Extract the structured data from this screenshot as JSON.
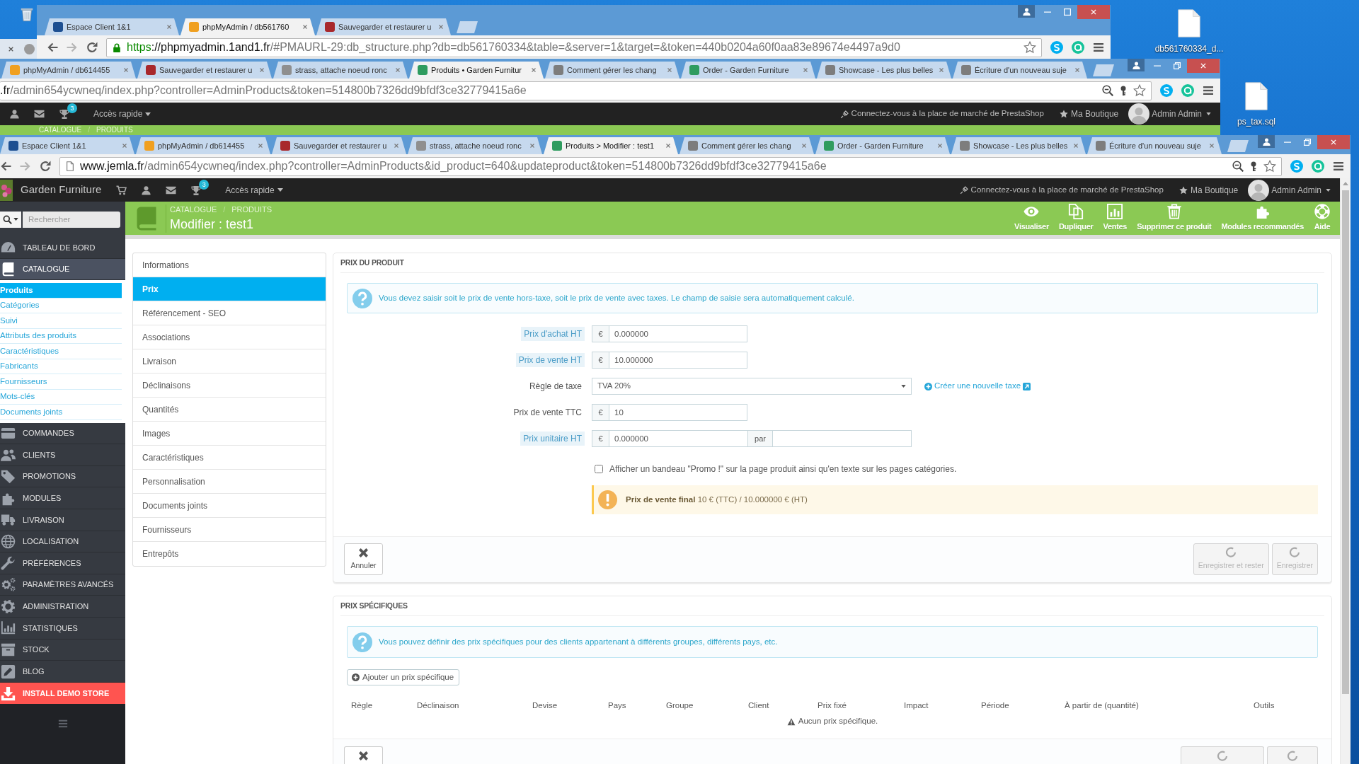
{
  "desktop": {
    "icons": [
      {
        "label": "db561760334_d..."
      },
      {
        "label": "ps_tax.sql"
      }
    ]
  },
  "windows": [
    {
      "kind": "sliver"
    },
    {
      "kind": "browser",
      "maximized": false,
      "tabs": [
        {
          "title": "Espace Client 1&1",
          "selected": false,
          "color": "#1d4f91"
        },
        {
          "title": "phpMyAdmin / db561760",
          "selected": true,
          "color": "#f0a020"
        },
        {
          "title": "Sauvegarder et restaurer u",
          "selected": false,
          "color": "#a8282c"
        }
      ],
      "toolbar": {
        "nav_buttons": true,
        "secure": true,
        "url": [
          {
            "kind": "scheme",
            "text": "https"
          },
          {
            "kind": "host",
            "text": "://phpmyadmin.1and1.fr"
          },
          {
            "kind": "path",
            "text": "/#PMAURL-29:db_structure.php?db=db561760334&table=&server=1&target=&token=440b0204a60f0aa83e89674e4497a9d0"
          }
        ],
        "zoomed": false,
        "saved_password": false
      }
    },
    {
      "kind": "browser",
      "maximized": true,
      "tabs": [
        {
          "title": "phpMyAdmin / db614455",
          "selected": false,
          "color": "#f0a020"
        },
        {
          "title": "Sauvegarder et restaurer u",
          "selected": false,
          "color": "#a8282c"
        },
        {
          "title": "strass, attache noeud ronc",
          "selected": false,
          "color": "#8f8f8f"
        },
        {
          "title": "Produits • Garden Furnitur",
          "selected": true,
          "color": "#2f9c5f"
        },
        {
          "title": "Comment gérer les chang",
          "selected": false,
          "color": "#7d7d7d"
        },
        {
          "title": "Order - Garden Furniture",
          "selected": false,
          "color": "#2f9c5f"
        },
        {
          "title": "Showcase - Les plus belles",
          "selected": false,
          "color": "#7d7d7d"
        },
        {
          "title": "Écriture d'un nouveau suje",
          "selected": false,
          "color": "#7d7d7d"
        }
      ],
      "toolbar": {
        "nav_buttons": false,
        "url": [
          {
            "kind": "host",
            "text": ".fr"
          },
          {
            "kind": "path",
            "text": "/admin654ycwneq/index.php?controller=AdminProducts&token=514800b7326dd9bfdf3ce32779415a6e"
          }
        ],
        "zoomed": true,
        "saved_password": true
      },
      "page": {
        "admin_header": {
          "notifications": "3",
          "quick_access": "Accès rapide",
          "marketplace": "Connectez-vous à la place de marché de PrestaShop",
          "shop": "Ma Boutique",
          "user": "Admin Admin"
        },
        "header": {
          "breadcrumb": [
            "CATALOGUE",
            "PRODUITS"
          ],
          "separator": "/"
        }
      }
    },
    {
      "kind": "browser",
      "maximized": true,
      "tabs": [
        {
          "title": "Espace Client 1&1",
          "selected": false,
          "color": "#1d4f91"
        },
        {
          "title": "phpMyAdmin / db614455",
          "selected": false,
          "color": "#f0a020"
        },
        {
          "title": "Sauvegarder et restaurer u",
          "selected": false,
          "color": "#a8282c"
        },
        {
          "title": "strass, attache noeud ronc",
          "selected": false,
          "color": "#8f8f8f"
        },
        {
          "title": "Produits > Modifier : test1",
          "selected": true,
          "color": "#2f9c5f"
        },
        {
          "title": "Comment gérer les chang",
          "selected": false,
          "color": "#7d7d7d"
        },
        {
          "title": "Order - Garden Furniture",
          "selected": false,
          "color": "#2f9c5f"
        },
        {
          "title": "Showcase - Les plus belles",
          "selected": false,
          "color": "#7d7d7d"
        },
        {
          "title": "Écriture d'un nouveau suje",
          "selected": false,
          "color": "#7d7d7d"
        }
      ],
      "toolbar": {
        "nav_buttons": true,
        "secure": false,
        "url": [
          {
            "kind": "host",
            "text": "www.jemla.fr"
          },
          {
            "kind": "path",
            "text": "/admin654ycwneq/index.php?controller=AdminProducts&id_product=640&updateproduct&token=514800b7326dd9bfdf3ce32779415a6e"
          }
        ],
        "zoomed": true,
        "saved_password": true
      },
      "page": {
        "admin_header": {
          "shop_name": "Garden Furniture",
          "notifications": "3",
          "quick_access": "Accès rapide",
          "marketplace": "Connectez-vous à la place de marché de PrestaShop",
          "shop": "Ma Boutique",
          "user": "Admin Admin"
        },
        "search": {
          "placeholder": "Rechercher"
        },
        "sidebar": [
          {
            "kind": "menu",
            "label": "TABLEAU DE BORD",
            "selected": false
          },
          {
            "kind": "menu",
            "label": "CATALOGUE",
            "selected": true,
            "children": [
              {
                "label": "Produits",
                "selected": true
              },
              {
                "label": "Catégories",
                "selected": false
              },
              {
                "label": "Suivi",
                "selected": false
              },
              {
                "label": "Attributs des produits",
                "selected": false
              },
              {
                "label": "Caractéristiques",
                "selected": false
              },
              {
                "label": "Fabricants",
                "selected": false
              },
              {
                "label": "Fournisseurs",
                "selected": false
              },
              {
                "label": "Mots-clés",
                "selected": false
              },
              {
                "label": "Documents joints",
                "selected": false
              }
            ]
          },
          {
            "kind": "menu",
            "label": "COMMANDES",
            "selected": false
          },
          {
            "kind": "menu",
            "label": "CLIENTS",
            "selected": false
          },
          {
            "kind": "menu",
            "label": "PROMOTIONS",
            "selected": false
          },
          {
            "kind": "menu",
            "label": "MODULES",
            "selected": false
          },
          {
            "kind": "menu",
            "label": "LIVRAISON",
            "selected": false
          },
          {
            "kind": "menu",
            "label": "LOCALISATION",
            "selected": false
          },
          {
            "kind": "menu",
            "label": "PRÉFÉRENCES",
            "selected": false
          },
          {
            "kind": "menu",
            "label": "PARAMÈTRES AVANCÉS",
            "selected": false
          },
          {
            "kind": "menu",
            "label": "ADMINISTRATION",
            "selected": false
          },
          {
            "kind": "menu",
            "label": "STATISTIQUES",
            "selected": false
          },
          {
            "kind": "menu",
            "label": "STOCK",
            "selected": false
          },
          {
            "kind": "menu",
            "label": "BLOG",
            "selected": false
          },
          {
            "kind": "promo",
            "label": "INSTALL DEMO STORE",
            "selected": false
          }
        ],
        "header": {
          "breadcrumb": [
            "CATALOGUE",
            "PRODUITS"
          ],
          "separator": "/",
          "title": "Modifier : test1",
          "actions": [
            "Visualiser",
            "Dupliquer",
            "Ventes",
            "Supprimer ce produit",
            "Modules recommandés",
            "Aide"
          ]
        },
        "product_tabs": [
          {
            "label": "Informations",
            "selected": false
          },
          {
            "label": "Prix",
            "selected": true
          },
          {
            "label": "Référencement - SEO",
            "selected": false
          },
          {
            "label": "Associations",
            "selected": false
          },
          {
            "label": "Livraison",
            "selected": false
          },
          {
            "label": "Déclinaisons",
            "selected": false
          },
          {
            "label": "Quantités",
            "selected": false
          },
          {
            "label": "Images",
            "selected": false
          },
          {
            "label": "Caractéristiques",
            "selected": false
          },
          {
            "label": "Personnalisation",
            "selected": false
          },
          {
            "label": "Documents joints",
            "selected": false
          },
          {
            "label": "Fournisseurs",
            "selected": false
          },
          {
            "label": "Entrepôts",
            "selected": false
          }
        ],
        "price_panel": {
          "title": "PRIX DU PRODUIT",
          "info": "Vous devez saisir soit le prix de vente hors-taxe, soit le prix de vente avec taxes. Le champ de saisie sera automatiquement calculé.",
          "fields": [
            {
              "kind": "money",
              "label": "Prix d'achat HT",
              "help": true,
              "currency": "€",
              "value": "0.000000"
            },
            {
              "kind": "money",
              "label": "Prix de vente HT",
              "help": true,
              "currency": "€",
              "value": "10.000000"
            },
            {
              "kind": "select",
              "label": "Règle de taxe",
              "help": false,
              "value": "TVA 20%",
              "link": "Créer une nouvelle taxe"
            },
            {
              "kind": "money",
              "label": "Prix de vente TTC",
              "help": false,
              "currency": "€",
              "value": "10"
            },
            {
              "kind": "unit",
              "label": "Prix unitaire HT",
              "help": true,
              "currency": "€",
              "value": "0.000000",
              "unit_label": "par"
            }
          ],
          "promo": {
            "label": "Afficher un bandeau \"Promo !\" sur la page produit ainsi qu'en texte sur les pages catégories.",
            "checked": false
          },
          "summary": "**Prix de vente final** 10 € (TTC) / 10.000000 € (HT)",
          "buttons": [
            {
              "kind": "cancel",
              "label": "Annuler",
              "disabled": false
            },
            {
              "kind": "save",
              "label": "Enregistrer et rester",
              "disabled": true
            },
            {
              "kind": "save",
              "label": "Enregistrer",
              "disabled": true
            }
          ]
        },
        "specific_panel": {
          "title": "PRIX SPÉCIFIQUES",
          "info": "Vous pouvez définir des prix spécifiques pour des clients appartenant à différents groupes, différents pays, etc.",
          "add": "Ajouter un prix spécifique",
          "columns": [
            "Règle",
            "Déclinaison",
            "Devise",
            "Pays",
            "Groupe",
            "Client",
            "Prix fixé",
            "Impact",
            "Période",
            "À partir de (quantité)",
            "Outils"
          ],
          "empty": "Aucun prix spécifique.",
          "buttons": [
            {
              "kind": "cancel",
              "disabled": false
            },
            {
              "kind": "save",
              "disabled": true
            },
            {
              "kind": "save",
              "disabled": true
            }
          ]
        }
      }
    }
  ]
}
